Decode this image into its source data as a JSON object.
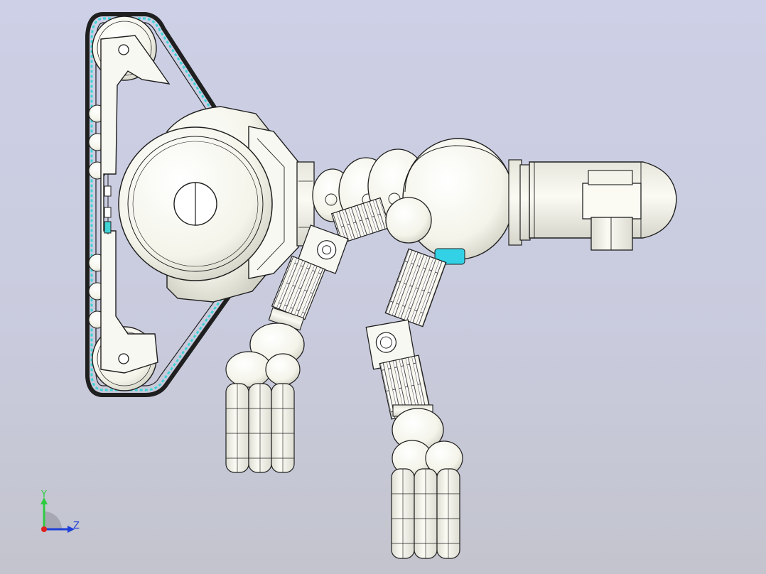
{
  "view": {
    "background_top": "#cdd0e6",
    "background_bottom": "#c3c4cd"
  },
  "colors": {
    "part_fill": "#f7f7ef",
    "part_shade": "#d9d9cf",
    "edge": "#1f1f1f",
    "track_accent": "#3fd3d6",
    "sensor_accent": "#33d1e6"
  },
  "triad": {
    "y_label": "Y",
    "z_label": "Z",
    "y_color": "#2ecc40",
    "z_color": "#1f3fd8",
    "x_color": "#e02020"
  }
}
